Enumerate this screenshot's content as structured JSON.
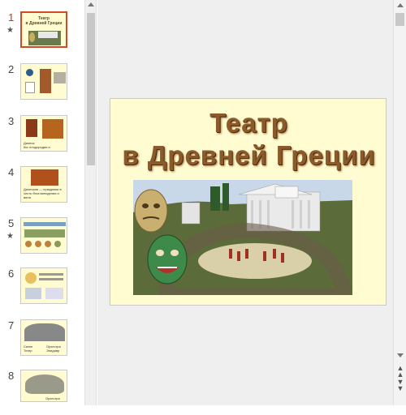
{
  "thumbnails": [
    {
      "number": "1",
      "star": "★",
      "title": "Театр\nв Древней Греции"
    },
    {
      "number": "2",
      "star": ""
    },
    {
      "number": "3",
      "star": "",
      "caption": "Дионис\nбог плодородия и виноделия"
    },
    {
      "number": "4",
      "star": "",
      "caption": "Дионисии — праздники в честь бога виноделия и вина"
    },
    {
      "number": "5",
      "star": "★"
    },
    {
      "number": "6",
      "star": ""
    },
    {
      "number": "7",
      "star": "",
      "caption_left": "Скене\nТеатр",
      "caption_right": "Орхестра\nЭпидавр"
    },
    {
      "number": "8",
      "star": "",
      "caption": "Орхестра"
    }
  ],
  "slide": {
    "title_line1": "Театр",
    "title_line2": "в Древней Греции"
  },
  "colors": {
    "slide_bg": "#fefcd0",
    "title": "#8b5a2b",
    "active_border": "#d04a2b"
  }
}
